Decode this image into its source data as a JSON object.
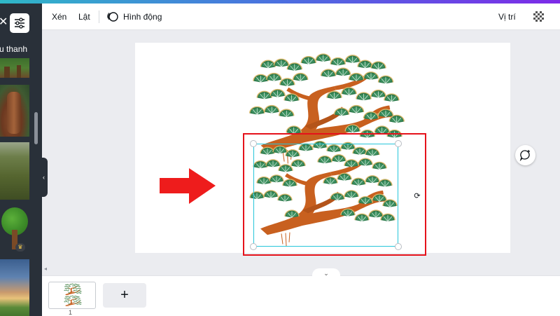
{
  "toolbar": {
    "crop_label": "Xén",
    "flip_label": "Lật",
    "animate_label": "Hình động",
    "position_label": "Vị trí",
    "transparency_icon": "checkerboard-icon"
  },
  "left_panel": {
    "partial_text": "u thanh",
    "close_icon": "close-icon",
    "filter_icon": "filter-icon",
    "premium_badge": "crown-icon"
  },
  "canvas": {
    "annotation_arrow": "red-arrow-icon",
    "selection_color": "#26c6da",
    "highlight_color": "#e5121b"
  },
  "pages": {
    "current_page": "1",
    "add_page_label": "+"
  },
  "colors": {
    "accent": "#7d2ae8",
    "sidebar": "#293039",
    "workspace": "#ebecf0"
  }
}
